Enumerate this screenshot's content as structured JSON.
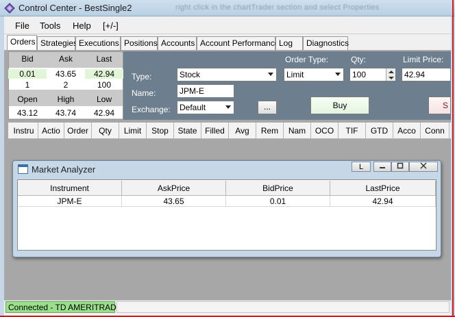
{
  "window": {
    "title": "Control Center - BestSingle2",
    "blurred_caption": "right click in the chartTrader section and select Properties"
  },
  "menu": [
    "File",
    "Tools",
    "Help",
    "[+/-]"
  ],
  "tabs": [
    "Orders",
    "Strategies",
    "Executions",
    "Positions",
    "Accounts",
    "Account Performance",
    "Log",
    "Diagnostics"
  ],
  "quote": {
    "headers": [
      "Bid",
      "Ask",
      "Last"
    ],
    "prices": [
      "0.01",
      "43.65",
      "42.94"
    ],
    "sizes": [
      "1",
      "2",
      "100"
    ],
    "headers2": [
      "Open",
      "High",
      "Low"
    ],
    "values2": [
      "43.12",
      "43.74",
      "42.94"
    ]
  },
  "order_entry": {
    "type_label": "Type:",
    "type_value": "Stock",
    "name_label": "Name:",
    "name_value": "JPM-E",
    "exchange_label": "Exchange:",
    "exchange_value": "Default",
    "ellipsis_label": "...",
    "order_type_label": "Order Type:",
    "order_type_value": "Limit",
    "qty_label": "Qty:",
    "qty_value": "100",
    "limit_price_label": "Limit Price:",
    "limit_price_value": "42.94",
    "buy_label": "Buy",
    "sell_label": "S"
  },
  "orders_columns": [
    "Instru",
    "Actio",
    "Order",
    "Qty",
    "Limit",
    "Stop",
    "State",
    "Filled",
    "Avg",
    "Rem",
    "Nam",
    "OCO",
    "TIF",
    "GTD",
    "Acco",
    "Conn"
  ],
  "market_analyzer": {
    "title": "Market Analyzer",
    "link_button": "L",
    "columns": [
      "Instrument",
      "AskPrice",
      "BidPrice",
      "LastPrice"
    ],
    "rows": [
      {
        "instrument": "JPM-E",
        "ask": "43.65",
        "bid": "0.01",
        "last": "42.94"
      }
    ]
  },
  "status": {
    "connection": "Connected - TD AMERITRADE"
  },
  "colors": {
    "order_panel": "#6d7f8f",
    "connected": "#9ae08a",
    "title_bar": "#c5d8e8",
    "alert_border": "#d01818"
  }
}
